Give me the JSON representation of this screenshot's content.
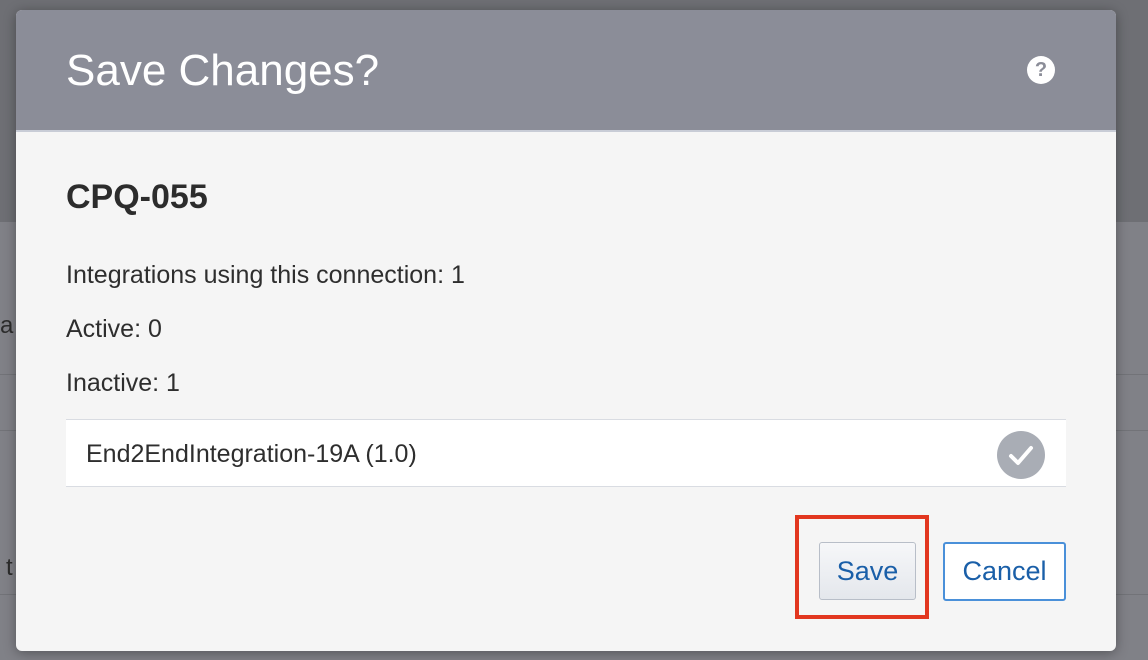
{
  "background": {
    "fragment_a": "a",
    "fragment_t": "t"
  },
  "dialog": {
    "title": "Save Changes?",
    "help_icon": "question-mark-icon",
    "help_glyph": "?",
    "connection_name": "CPQ-055",
    "stats": {
      "integrations": "Integrations using this connection: 1",
      "active": "Active: 0",
      "inactive": "Inactive: 1"
    },
    "integrations": [
      {
        "name": "End2EndIntegration-19A (1.0)",
        "status_icon": "checkmark-circle-icon"
      }
    ],
    "buttons": {
      "save_label": "Save",
      "cancel_label": "Cancel"
    }
  },
  "colors": {
    "header_bg": "#8b8d98",
    "dialog_bg": "#f5f5f5",
    "button_text": "#1a5fa8",
    "highlight": "#e2371f",
    "cancel_border": "#4a90d9"
  }
}
